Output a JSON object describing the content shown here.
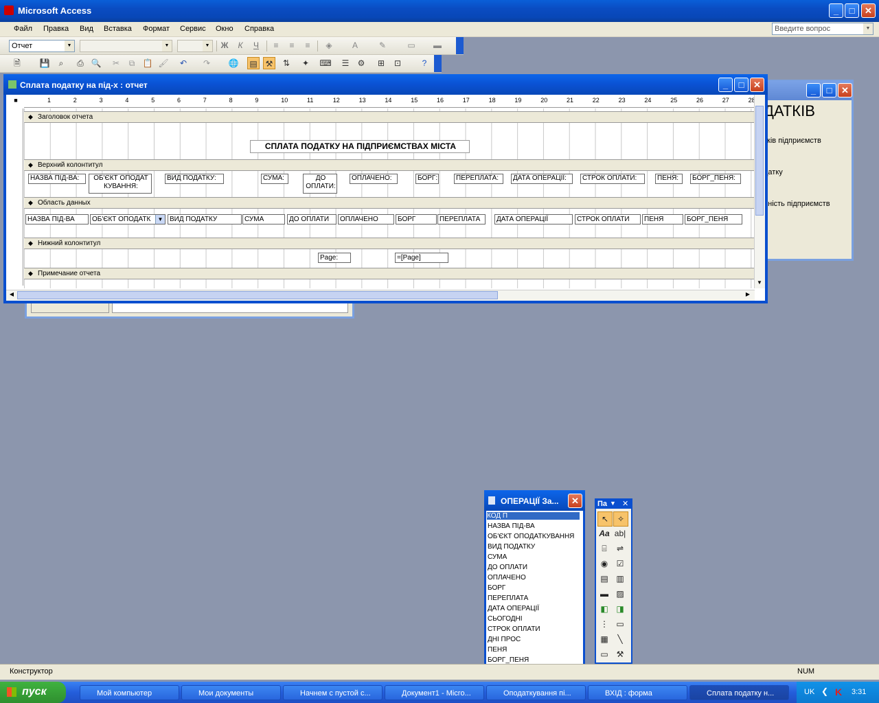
{
  "app": {
    "title": "Microsoft Access"
  },
  "menu": [
    "Файл",
    "Правка",
    "Вид",
    "Вставка",
    "Формат",
    "Сервис",
    "Окно",
    "Справка"
  ],
  "ask_placeholder": "Введите вопрос",
  "object_combo": "Отчет",
  "format_buttons": {
    "bold": "Ж",
    "italic": "К",
    "underline": "Ч"
  },
  "design_window": {
    "title": "Сплата податку на під-х : отчет",
    "ruler": [
      "1",
      "2",
      "3",
      "4",
      "5",
      "6",
      "7",
      "8",
      "9",
      "10",
      "11",
      "12",
      "13",
      "14",
      "15",
      "16",
      "17",
      "18",
      "19",
      "20",
      "21",
      "22",
      "23",
      "24",
      "25",
      "26",
      "27",
      "28"
    ],
    "sections": {
      "report_header": "Заголовок отчета",
      "page_header": "Верхний колонтитул",
      "detail": "Область данных",
      "page_footer": "Нижний колонтитул",
      "report_footer": "Примечание отчета"
    },
    "report_title": "СПЛАТА ПОДАТКУ НА ПІДПРИЄМСТВАХ МІСТА",
    "header_labels": [
      "НАЗВА ПІД-ВА:",
      "ОБ'ЄКТ ОПОДАТ КУВАННЯ:",
      "ВИД ПОДАТКУ:",
      "СУМА:",
      "ДО ОПЛАТИ:",
      "ОПЛАЧЕНО:",
      "БОРГ:",
      "ПЕРЕПЛАТА:",
      "ДАТА ОПЕРАЦІЇ:",
      "СТРОК ОПЛАТИ:",
      "ПЕНЯ:",
      "БОРГ_ПЕНЯ:"
    ],
    "detail_fields": [
      "НАЗВА ПІД-ВА",
      "ОБ'ЄКТ ОПОДАТК",
      "ВИД ПОДАТКУ",
      "СУМА",
      "ДО ОПЛАТИ",
      "ОПЛАЧЕНО",
      "БОРГ",
      "ПЕРЕПЛАТА",
      "ДАТА ОПЕРАЦІЇ",
      "СТРОК ОПЛАТИ",
      "ПЕНЯ",
      "БОРГ_ПЕНЯ"
    ],
    "footer_label": "Page:",
    "footer_field": "=[Page]"
  },
  "background_window": {
    "heading": "ДАТКІВ",
    "line1": "тків підприємств",
    "line2": "датку",
    "line3": "аність підприємств"
  },
  "field_list": {
    "title": "ОПЕРАЦІЇ За...",
    "items": [
      "КОД П",
      "НАЗВА ПІД-ВА",
      "ОБ'ЄКТ ОПОДАТКУВАННЯ",
      "ВИД ПОДАТКУ",
      "СУМА",
      "ДО ОПЛАТИ",
      "ОПЛАЧЕНО",
      "БОРГ",
      "ПЕРЕПЛАТА",
      "ДАТА ОПЕРАЦІЇ",
      "СЬОГОДНІ",
      "СТРОК ОПЛАТИ",
      "ДНІ ПРОС",
      "ПЕНЯ",
      "БОРГ_ПЕНЯ"
    ]
  },
  "toolbox": {
    "title": "Па"
  },
  "status": {
    "mode": "Конструктор",
    "num": "NUM"
  },
  "taskbar": {
    "start": "пуск",
    "tasks": [
      "Мой компьютер",
      "Мои документы",
      "Начнем с пустой с...",
      "Документ1 - Micro...",
      "Оподаткування пі...",
      "ВХІД : форма",
      "Сплата податку н..."
    ],
    "lang": "UK",
    "clock": "3:31"
  }
}
